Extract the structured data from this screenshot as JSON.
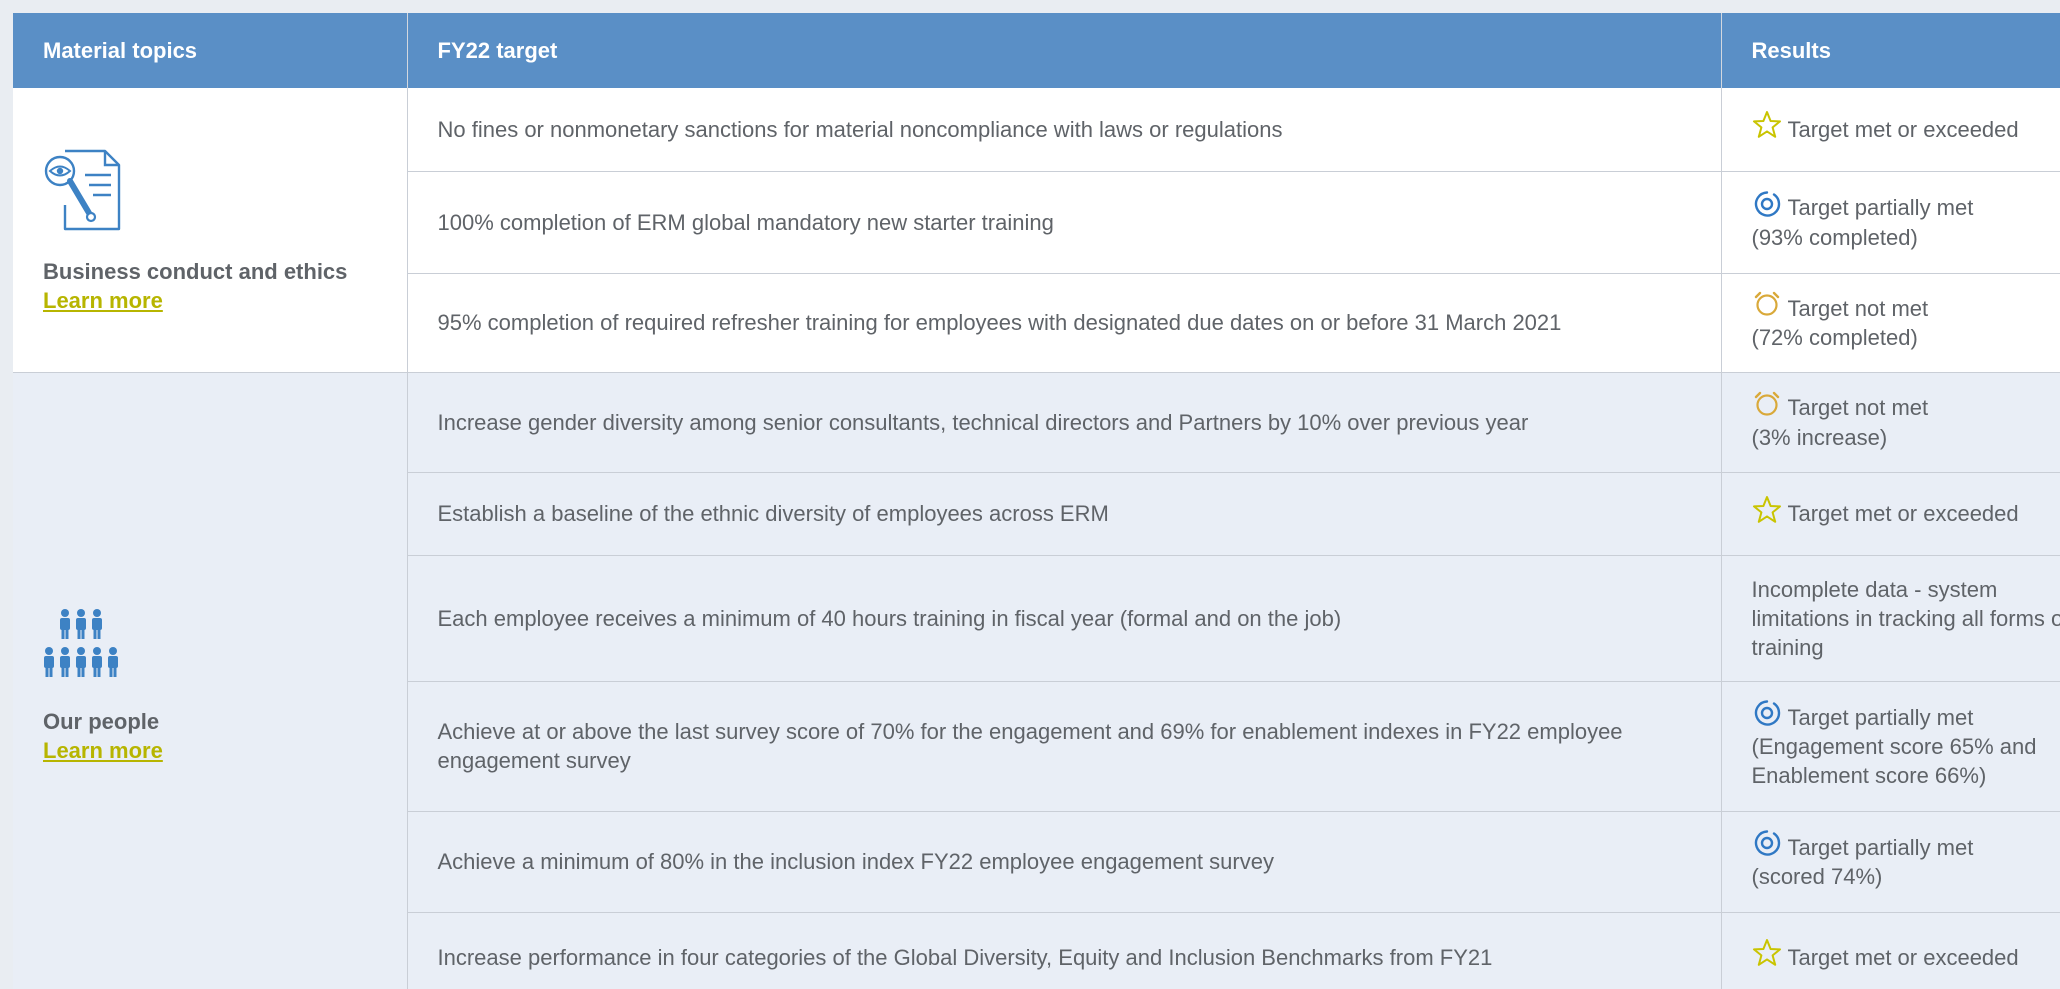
{
  "header": {
    "col1": "Material topics",
    "col2": "FY22 target",
    "col3": "Results"
  },
  "groups": [
    {
      "topic": "Business conduct and ethics",
      "learn_more": "Learn more",
      "icon": "document-magnifier-icon",
      "rows": [
        {
          "target": "No fines or nonmonetary sanctions for material noncompliance with laws or regulations",
          "status": "met",
          "result": "Target met or exceeded",
          "detail": ""
        },
        {
          "target": "100% completion of ERM global mandatory new starter training",
          "status": "partial",
          "result": "Target partially met",
          "detail": "(93% completed)"
        },
        {
          "target": "95% completion of required refresher training for employees with designated due dates on or before 31 March 2021",
          "status": "not-met",
          "result": "Target not met",
          "detail": "(72% completed)"
        }
      ]
    },
    {
      "topic": "Our people",
      "learn_more": "Learn more",
      "icon": "people-group-icon",
      "rows": [
        {
          "target": "Increase gender diversity among senior consultants, technical directors and Partners by 10% over previous year",
          "status": "not-met",
          "result": "Target not met",
          "detail": "(3% increase)"
        },
        {
          "target": "Establish a baseline of the ethnic diversity of employees across ERM",
          "status": "met",
          "result": "Target met or exceeded",
          "detail": ""
        },
        {
          "target": "Each employee receives a minimum of 40 hours training in fiscal year (formal and on the job)",
          "status": "none",
          "result": "",
          "detail": "Incomplete data - system limitations in tracking all forms of training"
        },
        {
          "target": "Achieve at or above the last survey score of 70% for the engagement and 69% for enablement indexes in FY22 employee engagement survey",
          "status": "partial",
          "result": "Target partially met",
          "detail": "(Engagement score 65% and Enablement score 66%)"
        },
        {
          "target": "Achieve a minimum of 80% in the inclusion index FY22 employee engagement survey",
          "status": "partial",
          "result": "Target partially met",
          "detail": "(scored 74%)"
        },
        {
          "target": "Increase performance in four categories of the Global Diversity, Equity and Inclusion Benchmarks from FY21",
          "status": "met",
          "result": "Target met or exceeded",
          "detail": ""
        }
      ]
    }
  ],
  "colors": {
    "header_bg": "#5a8fc6",
    "met_star": "#c9c400",
    "partial_target": "#2f78c4",
    "not_met": "#d9a93a",
    "link": "#b7b500"
  }
}
